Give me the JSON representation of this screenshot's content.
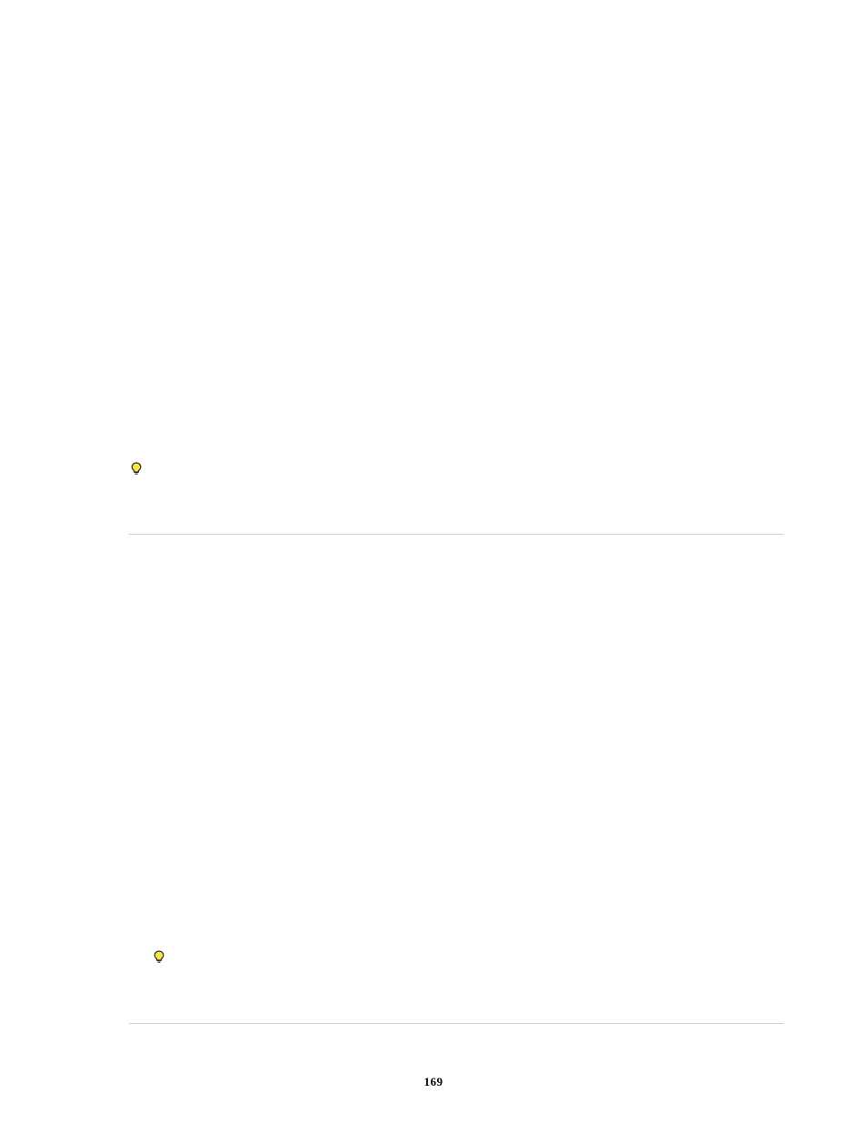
{
  "icons": {
    "bulb1": "lightbulb-icon",
    "bulb2": "lightbulb-icon"
  },
  "page_number": "169"
}
